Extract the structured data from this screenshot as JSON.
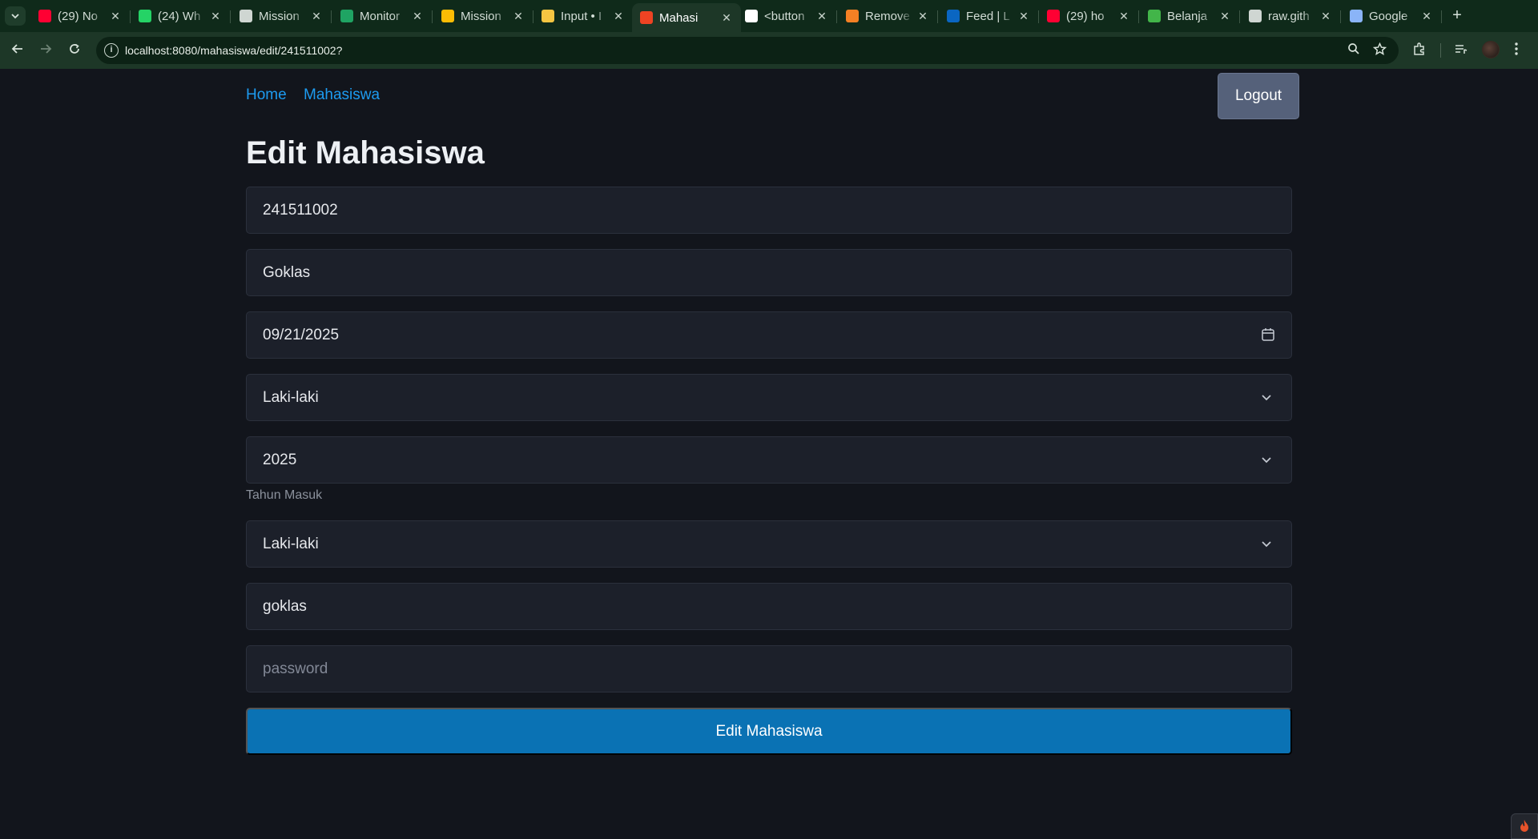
{
  "browser": {
    "tabs": [
      {
        "title": "(29) No",
        "favicon": "youtube-icon",
        "color": "#ff0033"
      },
      {
        "title": "(24) Wh",
        "favicon": "whatsapp-icon",
        "color": "#25d366"
      },
      {
        "title": "Mission",
        "favicon": "contact-card-icon",
        "color": "#cfd6d2"
      },
      {
        "title": "Monitor",
        "favicon": "google-sheets-icon",
        "color": "#1fa463"
      },
      {
        "title": "Mission",
        "favicon": "google-drive-icon",
        "color": "#fbbc04"
      },
      {
        "title": "Input • I",
        "favicon": "sparkle-icon",
        "color": "#f5c542"
      },
      {
        "title": "Mahasi",
        "favicon": "codeigniter-flame-icon",
        "color": "#ee4323",
        "active": true
      },
      {
        "title": "<button",
        "favicon": "m-logo-icon",
        "color": "#ffffff"
      },
      {
        "title": "Remove",
        "favicon": "stackoverflow-icon",
        "color": "#f48024"
      },
      {
        "title": "Feed | L",
        "favicon": "linkedin-icon",
        "color": "#0a66c2"
      },
      {
        "title": "(29) ho",
        "favicon": "youtube-icon",
        "color": "#ff0033"
      },
      {
        "title": "Belanja",
        "favicon": "shopping-bag-icon",
        "color": "#42b549"
      },
      {
        "title": "raw.gith",
        "favicon": "globe-icon",
        "color": "#cfd6d2"
      },
      {
        "title": "Google",
        "favicon": "gemini-star-icon",
        "color": "#8ab4f8"
      }
    ],
    "url": "localhost:8080/mahasiswa/edit/241511002?"
  },
  "nav": {
    "home": "Home",
    "mahasiswa": "Mahasiswa",
    "logout": "Logout"
  },
  "page": {
    "title": "Edit Mahasiswa"
  },
  "form": {
    "nim": "241511002",
    "nama": "Goklas",
    "tanggal_lahir": "09/21/2025",
    "jenis_kelamin": "Laki-laki",
    "tahun_masuk": "2025",
    "tahun_masuk_helper": "Tahun Masuk",
    "jenis_kelamin_2": "Laki-laki",
    "username": "goklas",
    "password_placeholder": "password",
    "submit_label": "Edit Mahasiswa"
  },
  "colors": {
    "page_bg": "#12151c",
    "field_bg": "#1c202a",
    "link": "#1d9bf0",
    "submit_bg": "#0a72b4",
    "logout_bg": "#55617a",
    "chrome_frame": "#0f2a1a"
  }
}
